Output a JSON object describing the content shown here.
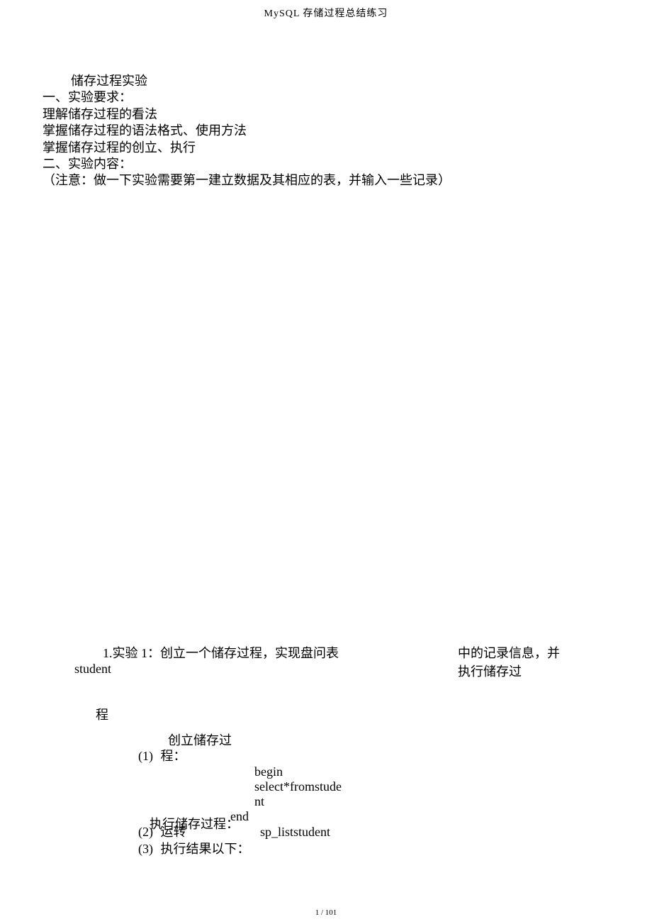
{
  "header": {
    "title": "MySQL 存储过程总结练习"
  },
  "intro": {
    "title": "储存过程实验",
    "section1_header": "一、实验要求：",
    "req1": "理解储存过程的看法",
    "req2": "掌握储存过程的语法格式、使用方法",
    "req3": "掌握储存过程的创立、执行",
    "section2_header": "二、实验内容：",
    "note": "（注意：做一下实验需要第一建立数据及其相应的表，并输入一些记录）"
  },
  "experiment1": {
    "header_left_line1": "1.实验 1：创立一个储存过程，实现盘问表",
    "header_left_line2": "student",
    "header_right_line1": "中的记录信息，并",
    "header_right_line2": "执行储存过",
    "cheng": "程",
    "step1": {
      "create_label": "创立储存过",
      "num": "(1)",
      "cheng": "程：",
      "code_begin": "begin",
      "code_select": "select*fromstude",
      "code_nt": "nt",
      "code_end": "end"
    },
    "step2": {
      "exec_label": "执行储存过程：",
      "num": "(2)",
      "run": "运转",
      "proc_name": "sp_liststudent"
    },
    "step3": {
      "num": "(3)",
      "label": "执行结果以下："
    }
  },
  "footer": {
    "page": "1 / 101"
  }
}
